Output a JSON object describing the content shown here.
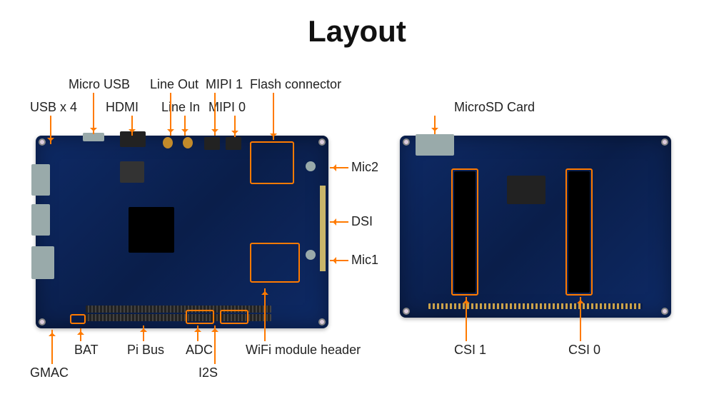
{
  "title": "Layout",
  "left": {
    "top_row": {
      "micro_usb": "Micro USB",
      "line_out": "Line Out",
      "mipi1": "MIPI 1",
      "flash_connector": "Flash connector"
    },
    "second_row": {
      "usb_x4": "USB x 4",
      "hdmi": "HDMI",
      "line_in": "Line In",
      "mipi0": "MIPI 0"
    },
    "right_side": {
      "mic2": "Mic2",
      "dsi": "DSI",
      "mic1": "Mic1"
    },
    "bottom": {
      "gmac": "GMAC",
      "bat": "BAT",
      "pi_bus": "Pi Bus",
      "adc": "ADC",
      "i2s": "I2S",
      "wifi_header": "WiFi module header"
    }
  },
  "right": {
    "top": {
      "microsd": "MicroSD Card"
    },
    "bottom": {
      "csi1": "CSI 1",
      "csi0": "CSI 0"
    }
  }
}
